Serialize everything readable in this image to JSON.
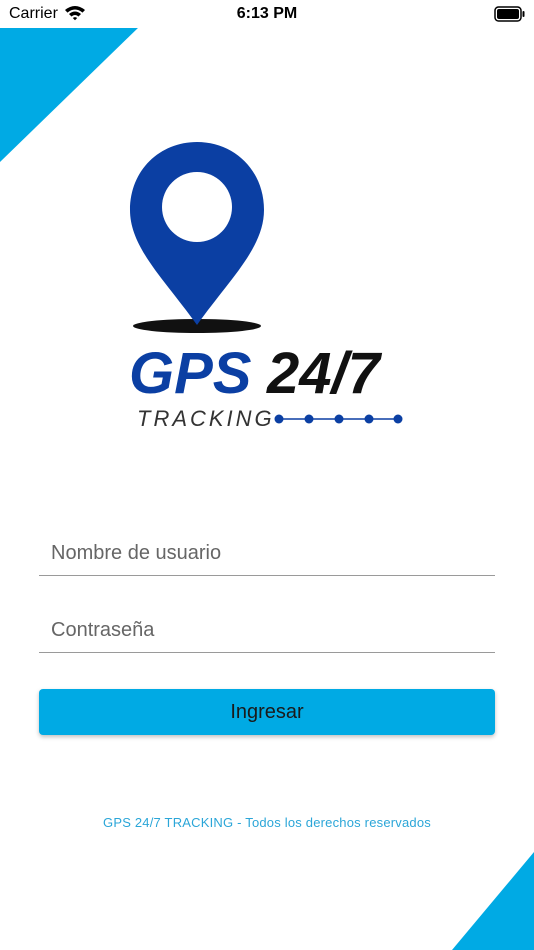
{
  "status_bar": {
    "carrier": "Carrier",
    "time": "6:13 PM",
    "wifi_icon": "wifi-icon",
    "battery_icon": "battery-icon"
  },
  "logo": {
    "brand": "GPS",
    "brand_suffix": "24/7",
    "tagline": "TRACKING",
    "pin_icon": "map-pin-icon"
  },
  "login_form": {
    "username_placeholder": "Nombre de usuario",
    "username_value": "",
    "password_placeholder": "Contraseña",
    "password_value": "",
    "submit_label": "Ingresar"
  },
  "footer": {
    "copyright": "GPS 24/7 TRACKING - Todos los derechos reservados"
  },
  "colors": {
    "accent": "#00aae4",
    "logo_blue": "#0b3fa3",
    "logo_black": "#111111",
    "footer_text": "#2ba6d8"
  }
}
